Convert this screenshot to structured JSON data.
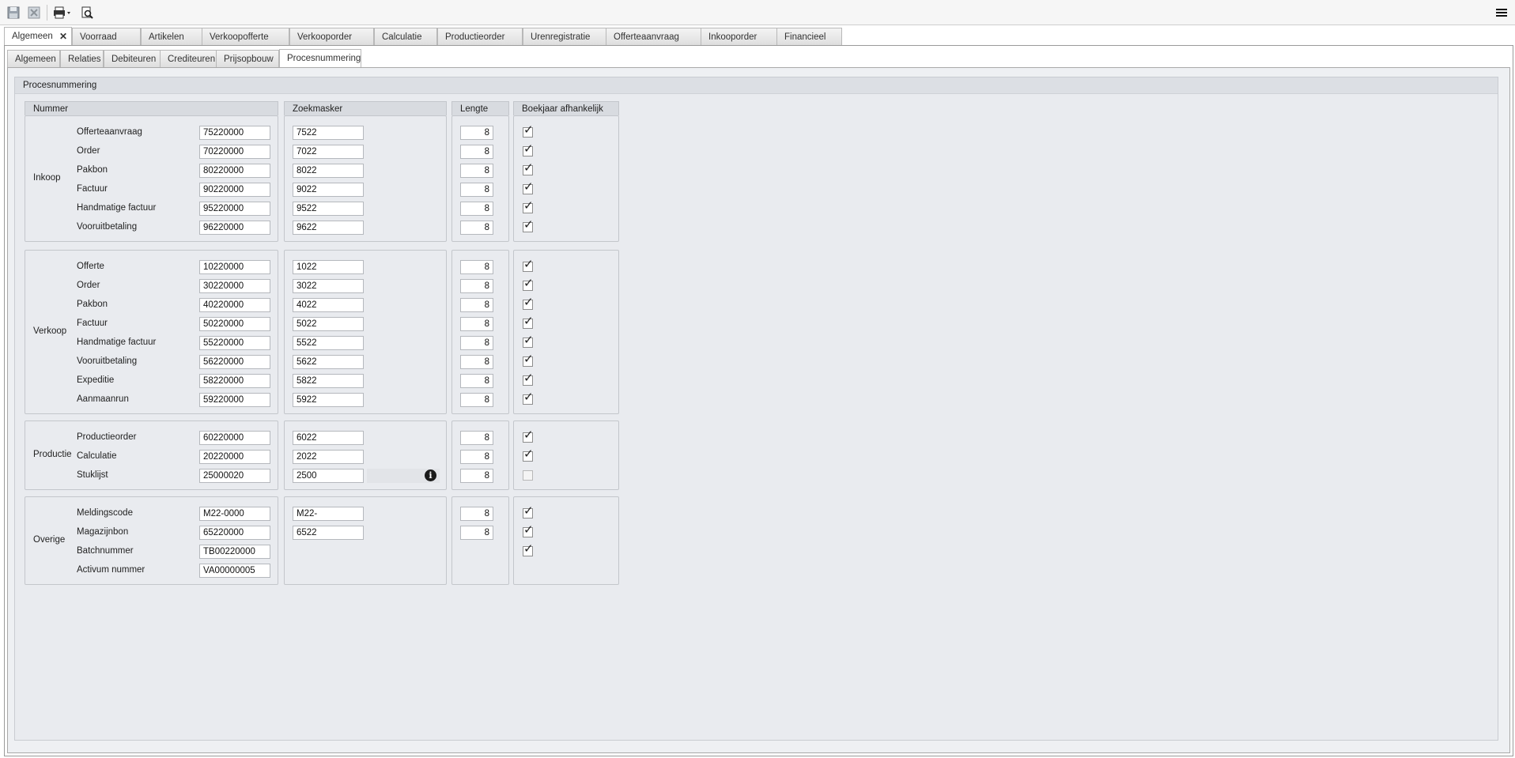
{
  "toolbar": {
    "icons": [
      "save-icon",
      "discard-icon",
      "print-icon",
      "print-preview-icon",
      "menu-icon"
    ]
  },
  "main_tabs": [
    {
      "label": "Algemeen"
    },
    {
      "label": "Voorraad"
    },
    {
      "label": "Artikelen"
    },
    {
      "label": "Verkoopofferte"
    },
    {
      "label": "Verkooporder"
    },
    {
      "label": "Calculatie"
    },
    {
      "label": "Productieorder"
    },
    {
      "label": "Urenregistratie"
    },
    {
      "label": "Offerteaanvraag"
    },
    {
      "label": "Inkooporder"
    },
    {
      "label": "Financieel"
    }
  ],
  "sub_tabs": [
    {
      "label": "Algemeen"
    },
    {
      "label": "Relaties"
    },
    {
      "label": "Debiteuren"
    },
    {
      "label": "Crediteuren"
    },
    {
      "label": "Prijsopbouw"
    },
    {
      "label": "Procesnummering"
    }
  ],
  "panel": {
    "title": "Procesnummering",
    "headers": {
      "nummer": "Nummer",
      "zoekmasker": "Zoekmasker",
      "lengte": "Lengte",
      "boekjaar": "Boekjaar afhankelijk"
    },
    "groups": [
      {
        "name": "Inkoop",
        "rows": [
          {
            "label": "Offerteaanvraag",
            "nummer": "75220000",
            "zoekmasker": "7522",
            "lengte": "8",
            "boekjaar": true
          },
          {
            "label": "Order",
            "nummer": "70220000",
            "zoekmasker": "7022",
            "lengte": "8",
            "boekjaar": true
          },
          {
            "label": "Pakbon",
            "nummer": "80220000",
            "zoekmasker": "8022",
            "lengte": "8",
            "boekjaar": true
          },
          {
            "label": "Factuur",
            "nummer": "90220000",
            "zoekmasker": "9022",
            "lengte": "8",
            "boekjaar": true
          },
          {
            "label": "Handmatige factuur",
            "nummer": "95220000",
            "zoekmasker": "9522",
            "lengte": "8",
            "boekjaar": true
          },
          {
            "label": "Vooruitbetaling",
            "nummer": "96220000",
            "zoekmasker": "9622",
            "lengte": "8",
            "boekjaar": true
          }
        ]
      },
      {
        "name": "Verkoop",
        "rows": [
          {
            "label": "Offerte",
            "nummer": "10220000",
            "zoekmasker": "1022",
            "lengte": "8",
            "boekjaar": true
          },
          {
            "label": "Order",
            "nummer": "30220000",
            "zoekmasker": "3022",
            "lengte": "8",
            "boekjaar": true
          },
          {
            "label": "Pakbon",
            "nummer": "40220000",
            "zoekmasker": "4022",
            "lengte": "8",
            "boekjaar": true
          },
          {
            "label": "Factuur",
            "nummer": "50220000",
            "zoekmasker": "5022",
            "lengte": "8",
            "boekjaar": true
          },
          {
            "label": "Handmatige factuur",
            "nummer": "55220000",
            "zoekmasker": "5522",
            "lengte": "8",
            "boekjaar": true
          },
          {
            "label": "Vooruitbetaling",
            "nummer": "56220000",
            "zoekmasker": "5622",
            "lengte": "8",
            "boekjaar": true
          },
          {
            "label": "Expeditie",
            "nummer": "58220000",
            "zoekmasker": "5822",
            "lengte": "8",
            "boekjaar": true
          },
          {
            "label": "Aanmaanrun",
            "nummer": "59220000",
            "zoekmasker": "5922",
            "lengte": "8",
            "boekjaar": true
          }
        ]
      },
      {
        "name": "Productie",
        "rows": [
          {
            "label": "Productieorder",
            "nummer": "60220000",
            "zoekmasker": "6022",
            "lengte": "8",
            "boekjaar": true
          },
          {
            "label": "Calculatie",
            "nummer": "20220000",
            "zoekmasker": "2022",
            "lengte": "8",
            "boekjaar": true
          },
          {
            "label": "Stuklijst",
            "nummer": "25000020",
            "zoekmasker": "2500",
            "lengte": "8",
            "boekjaar": false,
            "info": true
          }
        ]
      },
      {
        "name": "Overige",
        "rows": [
          {
            "label": "Meldingscode",
            "nummer": "M22-0000",
            "zoekmasker": "M22-",
            "lengte": "8",
            "boekjaar": true
          },
          {
            "label": "Magazijnbon",
            "nummer": "65220000",
            "zoekmasker": "6522",
            "lengte": "8",
            "boekjaar": true
          },
          {
            "label": "Batchnummer",
            "nummer": "TB00220000",
            "zoekmasker": null,
            "lengte": null,
            "boekjaar": true
          },
          {
            "label": "Activum nummer",
            "nummer": "VA00000005",
            "zoekmasker": null,
            "lengte": null,
            "boekjaar": null
          }
        ]
      }
    ]
  }
}
